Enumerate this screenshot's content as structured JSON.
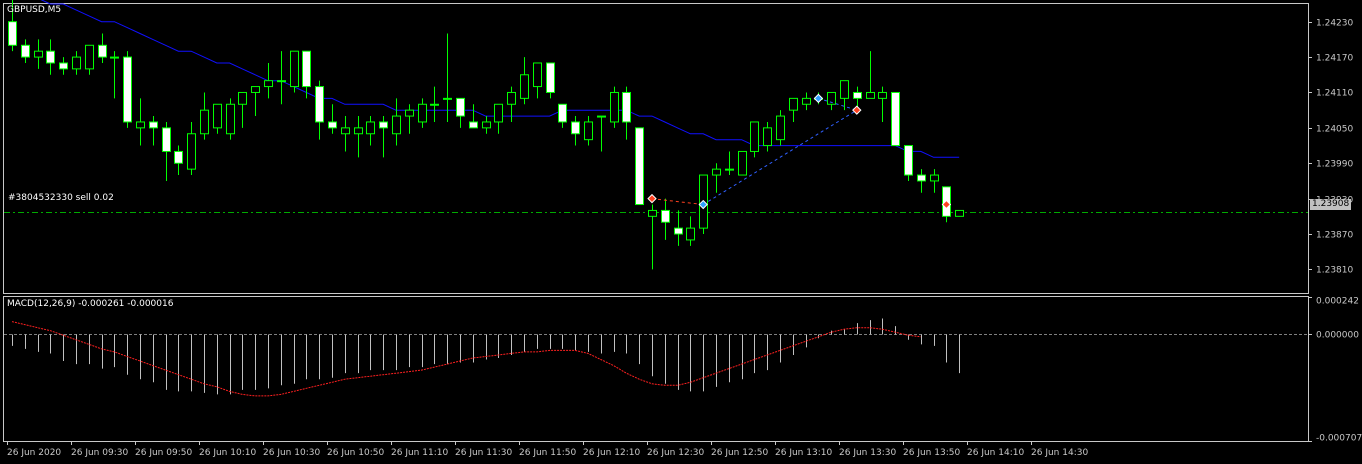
{
  "window": {
    "symbol_title": "GBPUSD,M5",
    "indicator_title": "MACD(12,26,9) -0.000261 -0.000016",
    "order_label": "#3804532330 sell 0.02",
    "current_price_tag": "1.23908"
  },
  "colors": {
    "background": "#000000",
    "frame": "#c8c8c8",
    "bull_body": "#000000",
    "bull_wick": "#00ff00",
    "bear_body": "#ffffff",
    "moving_average": "#1010ff",
    "order_line": "#00aa00",
    "macd_histogram": "#c0c0c0",
    "macd_signal": "#ff2020",
    "trade_arrow_sell": "#ff4020",
    "trade_arrow_buy": "#30a0ff",
    "price_tag_bg": "#c0c0c0"
  },
  "chart_data": [
    {
      "type": "candlestick",
      "title": "GBPUSD,M5",
      "ylim": [
        1.2377,
        1.2426
      ],
      "price_axis_ticks": [
        "1.24230",
        "1.24170",
        "1.24110",
        "1.24050",
        "1.23990",
        "1.23930",
        "1.23870",
        "1.23810"
      ],
      "time_axis_ticks": [
        "26 Jun 2020",
        "26 Jun 09:30",
        "26 Jun 09:50",
        "26 Jun 10:10",
        "26 Jun 10:30",
        "26 Jun 10:50",
        "26 Jun 11:10",
        "26 Jun 11:30",
        "26 Jun 11:50",
        "26 Jun 12:10",
        "26 Jun 12:30",
        "26 Jun 12:50",
        "26 Jun 13:10",
        "26 Jun 13:30",
        "26 Jun 13:50",
        "26 Jun 14:10",
        "26 Jun 14:30"
      ],
      "ohlc": [
        [
          1.2423,
          1.2427,
          1.2418,
          1.2419
        ],
        [
          1.2419,
          1.242,
          1.2416,
          1.2417
        ],
        [
          1.2417,
          1.242,
          1.2415,
          1.2418
        ],
        [
          1.2418,
          1.242,
          1.2414,
          1.2416
        ],
        [
          1.2416,
          1.2417,
          1.2414,
          1.2415
        ],
        [
          1.2415,
          1.2418,
          1.2414,
          1.2417
        ],
        [
          1.2415,
          1.2419,
          1.2414,
          1.2419
        ],
        [
          1.2419,
          1.2421,
          1.2416,
          1.2417
        ],
        [
          1.2417,
          1.2418,
          1.241,
          1.2417
        ],
        [
          1.2417,
          1.2418,
          1.2405,
          1.2406
        ],
        [
          1.2405,
          1.241,
          1.2402,
          1.2406
        ],
        [
          1.2406,
          1.2407,
          1.2402,
          1.2405
        ],
        [
          1.2405,
          1.2406,
          1.2396,
          1.2401
        ],
        [
          1.2401,
          1.2402,
          1.2397,
          1.2399
        ],
        [
          1.2398,
          1.2406,
          1.2397,
          1.2404
        ],
        [
          1.2404,
          1.2411,
          1.2403,
          1.2408
        ],
        [
          1.2405,
          1.2409,
          1.2404,
          1.2409
        ],
        [
          1.2404,
          1.241,
          1.2403,
          1.2409
        ],
        [
          1.2409,
          1.2411,
          1.2405,
          1.2411
        ],
        [
          1.2411,
          1.2412,
          1.2407,
          1.2412
        ],
        [
          1.2412,
          1.2416,
          1.241,
          1.2413
        ],
        [
          1.2413,
          1.2418,
          1.2409,
          1.2413
        ],
        [
          1.2412,
          1.2418,
          1.2411,
          1.2418
        ],
        [
          1.2418,
          1.2418,
          1.241,
          1.2412
        ],
        [
          1.2412,
          1.2413,
          1.2403,
          1.2406
        ],
        [
          1.2406,
          1.2409,
          1.2404,
          1.2405
        ],
        [
          1.2404,
          1.2407,
          1.2401,
          1.2405
        ],
        [
          1.2404,
          1.2407,
          1.24,
          1.2405
        ],
        [
          1.2404,
          1.2407,
          1.2402,
          1.2406
        ],
        [
          1.2406,
          1.2407,
          1.24,
          1.2405
        ],
        [
          1.2404,
          1.241,
          1.2402,
          1.2407
        ],
        [
          1.2407,
          1.2409,
          1.2404,
          1.2408
        ],
        [
          1.2406,
          1.241,
          1.2405,
          1.2409
        ],
        [
          1.2409,
          1.2412,
          1.2406,
          1.2409
        ],
        [
          1.241,
          1.2421,
          1.2406,
          1.241
        ],
        [
          1.241,
          1.241,
          1.2405,
          1.2407
        ],
        [
          1.2406,
          1.2409,
          1.2405,
          1.2405
        ],
        [
          1.2405,
          1.2407,
          1.2404,
          1.2406
        ],
        [
          1.2406,
          1.2409,
          1.2404,
          1.2409
        ],
        [
          1.2409,
          1.2412,
          1.2406,
          1.2411
        ],
        [
          1.241,
          1.2417,
          1.2409,
          1.2414
        ],
        [
          1.2412,
          1.2416,
          1.241,
          1.2416
        ],
        [
          1.2416,
          1.2416,
          1.241,
          1.2411
        ],
        [
          1.2409,
          1.2409,
          1.2405,
          1.2406
        ],
        [
          1.2406,
          1.2407,
          1.2402,
          1.2404
        ],
        [
          1.2403,
          1.2407,
          1.2402,
          1.2406
        ],
        [
          1.2407,
          1.2407,
          1.2401,
          1.2407
        ],
        [
          1.2406,
          1.2412,
          1.2405,
          1.2411
        ],
        [
          1.2411,
          1.2412,
          1.2403,
          1.2406
        ],
        [
          1.2405,
          1.2405,
          1.2392,
          1.2392
        ],
        [
          1.239,
          1.2392,
          1.2381,
          1.2391
        ],
        [
          1.2391,
          1.2393,
          1.2386,
          1.2389
        ],
        [
          1.2388,
          1.2391,
          1.2385,
          1.2387
        ],
        [
          1.2386,
          1.239,
          1.2385,
          1.2388
        ],
        [
          1.2388,
          1.2397,
          1.2387,
          1.2397
        ],
        [
          1.2397,
          1.2399,
          1.2394,
          1.2398
        ],
        [
          1.2398,
          1.2401,
          1.2397,
          1.2398
        ],
        [
          1.2397,
          1.2401,
          1.2397,
          1.2401
        ],
        [
          1.2401,
          1.2406,
          1.24,
          1.2406
        ],
        [
          1.2402,
          1.2406,
          1.2401,
          1.2405
        ],
        [
          1.2403,
          1.2408,
          1.2402,
          1.2407
        ],
        [
          1.2408,
          1.241,
          1.2406,
          1.241
        ],
        [
          1.2409,
          1.2411,
          1.2408,
          1.241
        ],
        [
          1.241,
          1.2411,
          1.2409,
          1.241
        ],
        [
          1.2409,
          1.2411,
          1.2408,
          1.2411
        ],
        [
          1.241,
          1.2413,
          1.2408,
          1.2413
        ],
        [
          1.2411,
          1.2412,
          1.2408,
          1.241
        ],
        [
          1.241,
          1.2418,
          1.241,
          1.2411
        ],
        [
          1.241,
          1.2412,
          1.2406,
          1.2411
        ],
        [
          1.2411,
          1.2411,
          1.2402,
          1.2402
        ],
        [
          1.2402,
          1.2402,
          1.2396,
          1.2397
        ],
        [
          1.2397,
          1.2398,
          1.2394,
          1.2396
        ],
        [
          1.2396,
          1.2398,
          1.2394,
          1.2397
        ],
        [
          1.2395,
          1.2395,
          1.2389,
          1.239
        ],
        [
          1.239,
          1.2391,
          1.239,
          1.2391
        ]
      ],
      "moving_average": [
        1.2429,
        1.2428,
        1.2427,
        1.2426,
        1.2426,
        1.2425,
        1.2424,
        1.2423,
        1.2423,
        1.2422,
        1.2421,
        1.242,
        1.2419,
        1.2418,
        1.2418,
        1.2417,
        1.2416,
        1.2416,
        1.2415,
        1.2414,
        1.2413,
        1.2413,
        1.2412,
        1.2411,
        1.241,
        1.241,
        1.2409,
        1.2409,
        1.2409,
        1.2409,
        1.2408,
        1.2408,
        1.2408,
        1.2408,
        1.2408,
        1.2408,
        1.2408,
        1.2407,
        1.2407,
        1.2407,
        1.2407,
        1.2407,
        1.2407,
        1.2408,
        1.2408,
        1.2408,
        1.2408,
        1.2408,
        1.2408,
        1.2407,
        1.2407,
        1.2406,
        1.2405,
        1.2404,
        1.2404,
        1.2403,
        1.2403,
        1.2403,
        1.2402,
        1.2402,
        1.2402,
        1.2402,
        1.2402,
        1.2402,
        1.2402,
        1.2402,
        1.2402,
        1.2402,
        1.2402,
        1.2402,
        1.2401,
        1.2401,
        1.24,
        1.24,
        1.24
      ],
      "order_line_price": 1.23908,
      "trade_arrows": [
        {
          "index": 50,
          "price": 1.2393,
          "side": "sell"
        },
        {
          "index": 54,
          "price": 1.2392,
          "side": "buy"
        },
        {
          "index": 63,
          "price": 1.241,
          "side": "buy"
        },
        {
          "index": 66,
          "price": 1.2408,
          "side": "sell"
        },
        {
          "index": 73,
          "price": 1.2392,
          "side": "sell"
        }
      ]
    },
    {
      "type": "bar",
      "title": "MACD(12,26,9) -0.000261 -0.000016",
      "ylim": [
        -0.000707,
        0.000242
      ],
      "value_axis_ticks": [
        "0.000242",
        "0.000000",
        "-0.000707"
      ],
      "values": [
        -8e-05,
        -0.0001,
        -0.00012,
        -0.00013,
        -0.00018,
        -0.0002,
        -0.0002,
        -0.00023,
        -0.00022,
        -0.00027,
        -0.0003,
        -0.00032,
        -0.00037,
        -0.00038,
        -0.00038,
        -0.00039,
        -0.0004,
        -0.0004,
        -0.00037,
        -0.00037,
        -0.00036,
        -0.00034,
        -0.00033,
        -0.0003,
        -0.0003,
        -0.00029,
        -0.00026,
        -0.00026,
        -0.00024,
        -0.00024,
        -0.00024,
        -0.00022,
        -0.00022,
        -0.0002,
        -0.0002,
        -0.00019,
        -0.00019,
        -0.00017,
        -0.00016,
        -0.00014,
        -0.00012,
        -0.0001,
        -0.0001,
        -0.0001,
        -0.00011,
        -0.00012,
        -0.00013,
        -0.00012,
        -0.00013,
        -0.0002,
        -0.00028,
        -0.00033,
        -0.00037,
        -0.00038,
        -0.00038,
        -0.00035,
        -0.00032,
        -0.0003,
        -0.00026,
        -0.00024,
        -0.00019,
        -0.00014,
        -9e-05,
        -3e-05,
        2e-05,
        3e-05,
        7e-05,
        9e-05,
        0.0001,
        5e-05,
        -4e-05,
        -7e-05,
        -8e-05,
        -0.00019,
        -0.00026
      ],
      "signal": [
        8e-05,
        6e-05,
        4e-05,
        2e-05,
        -1e-05,
        -4e-05,
        -7e-05,
        -0.0001,
        -0.00012,
        -0.00015,
        -0.00018,
        -0.00021,
        -0.00024,
        -0.00027,
        -0.0003,
        -0.00033,
        -0.00035,
        -0.00038,
        -0.0004,
        -0.00041,
        -0.00041,
        -0.0004,
        -0.00038,
        -0.00036,
        -0.00034,
        -0.00032,
        -0.0003,
        -0.00029,
        -0.00028,
        -0.00027,
        -0.00026,
        -0.00025,
        -0.00024,
        -0.00022,
        -0.0002,
        -0.00018,
        -0.00016,
        -0.00015,
        -0.00014,
        -0.00013,
        -0.00012,
        -0.00012,
        -0.00011,
        -0.00011,
        -0.00011,
        -0.00013,
        -0.00017,
        -0.00021,
        -0.00026,
        -0.0003,
        -0.00033,
        -0.00034,
        -0.00034,
        -0.00032,
        -0.00029,
        -0.00026,
        -0.00023,
        -0.0002,
        -0.00017,
        -0.00014,
        -0.00011,
        -8e-05,
        -5e-05,
        -2e-05,
        1e-05,
        3e-05,
        4e-05,
        4e-05,
        3e-05,
        1e-05,
        -1e-05,
        -2e-05
      ]
    }
  ]
}
